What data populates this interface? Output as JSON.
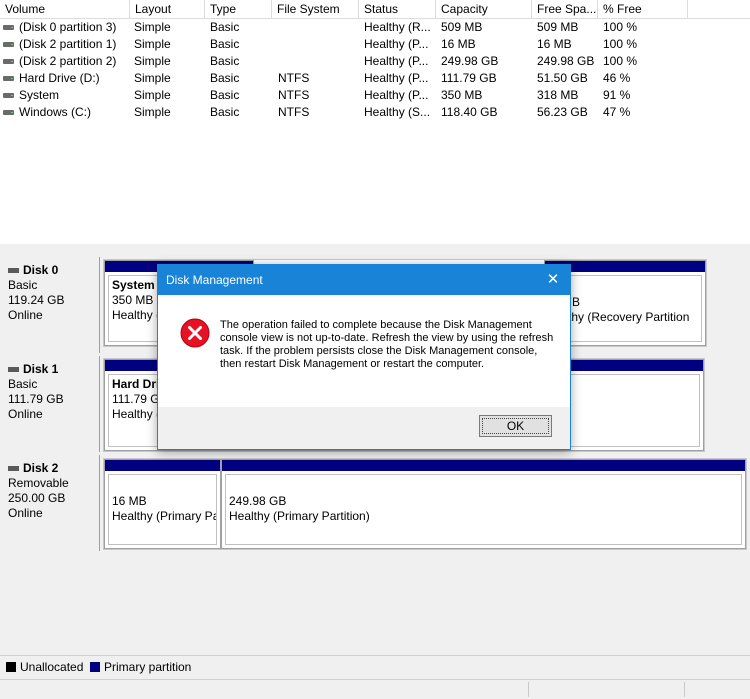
{
  "volume_list": {
    "columns": [
      "Volume",
      "Layout",
      "Type",
      "File System",
      "Status",
      "Capacity",
      "Free Spa...",
      "% Free"
    ],
    "rows": [
      {
        "volume": "(Disk 0 partition 3)",
        "layout": "Simple",
        "type": "Basic",
        "fs": "",
        "status": "Healthy (R...",
        "capacity": "509 MB",
        "free": "509 MB",
        "pct": "100 %"
      },
      {
        "volume": "(Disk 2 partition 1)",
        "layout": "Simple",
        "type": "Basic",
        "fs": "",
        "status": "Healthy (P...",
        "capacity": "16 MB",
        "free": "16 MB",
        "pct": "100 %"
      },
      {
        "volume": "(Disk 2 partition 2)",
        "layout": "Simple",
        "type": "Basic",
        "fs": "",
        "status": "Healthy (P...",
        "capacity": "249.98 GB",
        "free": "249.98 GB",
        "pct": "100 %"
      },
      {
        "volume": "Hard Drive (D:)",
        "layout": "Simple",
        "type": "Basic",
        "fs": "NTFS",
        "status": "Healthy (P...",
        "capacity": "111.79 GB",
        "free": "51.50 GB",
        "pct": "46 %"
      },
      {
        "volume": "System",
        "layout": "Simple",
        "type": "Basic",
        "fs": "NTFS",
        "status": "Healthy (P...",
        "capacity": "350 MB",
        "free": "318 MB",
        "pct": "91 %"
      },
      {
        "volume": "Windows (C:)",
        "layout": "Simple",
        "type": "Basic",
        "fs": "NTFS",
        "status": "Healthy (S...",
        "capacity": "118.40 GB",
        "free": "56.23 GB",
        "pct": "47 %"
      }
    ]
  },
  "disks": [
    {
      "name": "Disk 0",
      "kind": "Basic",
      "size": "119.24 GB",
      "state": "Online",
      "partitions": [
        {
          "title": "System",
          "size": "350 MB N",
          "status": "Healthy ("
        },
        {
          "title": "",
          "size": "9 MB",
          "status": "ealthy (Recovery Partition"
        }
      ]
    },
    {
      "name": "Disk 1",
      "kind": "Basic",
      "size": "111.79 GB",
      "state": "Online",
      "partitions": [
        {
          "title": "Hard Dri",
          "size": "111.79 G",
          "status": "Healthy ("
        }
      ]
    },
    {
      "name": "Disk 2",
      "kind": "Removable",
      "size": "250.00 GB",
      "state": "Online",
      "partitions": [
        {
          "title": "",
          "size": "16 MB",
          "status": "Healthy (Primary Pa"
        },
        {
          "title": "",
          "size": "249.98 GB",
          "status": "Healthy (Primary Partition)"
        }
      ]
    }
  ],
  "legend": [
    {
      "label": "Unallocated",
      "color": "#000000"
    },
    {
      "label": "Primary partition",
      "color": "#000080"
    }
  ],
  "dialog": {
    "title": "Disk Management",
    "close_glyph": "✕",
    "icon": "error-icon",
    "message": "The operation failed to complete because the Disk Management console view is not up-to-date.  Refresh the view by using the refresh task. If the problem persists close the Disk Management console, then restart Disk Management or restart the computer.",
    "ok_label": "OK"
  },
  "colors": {
    "accent": "#1883d7",
    "partition_bar": "#000080",
    "error": "#e81123"
  }
}
